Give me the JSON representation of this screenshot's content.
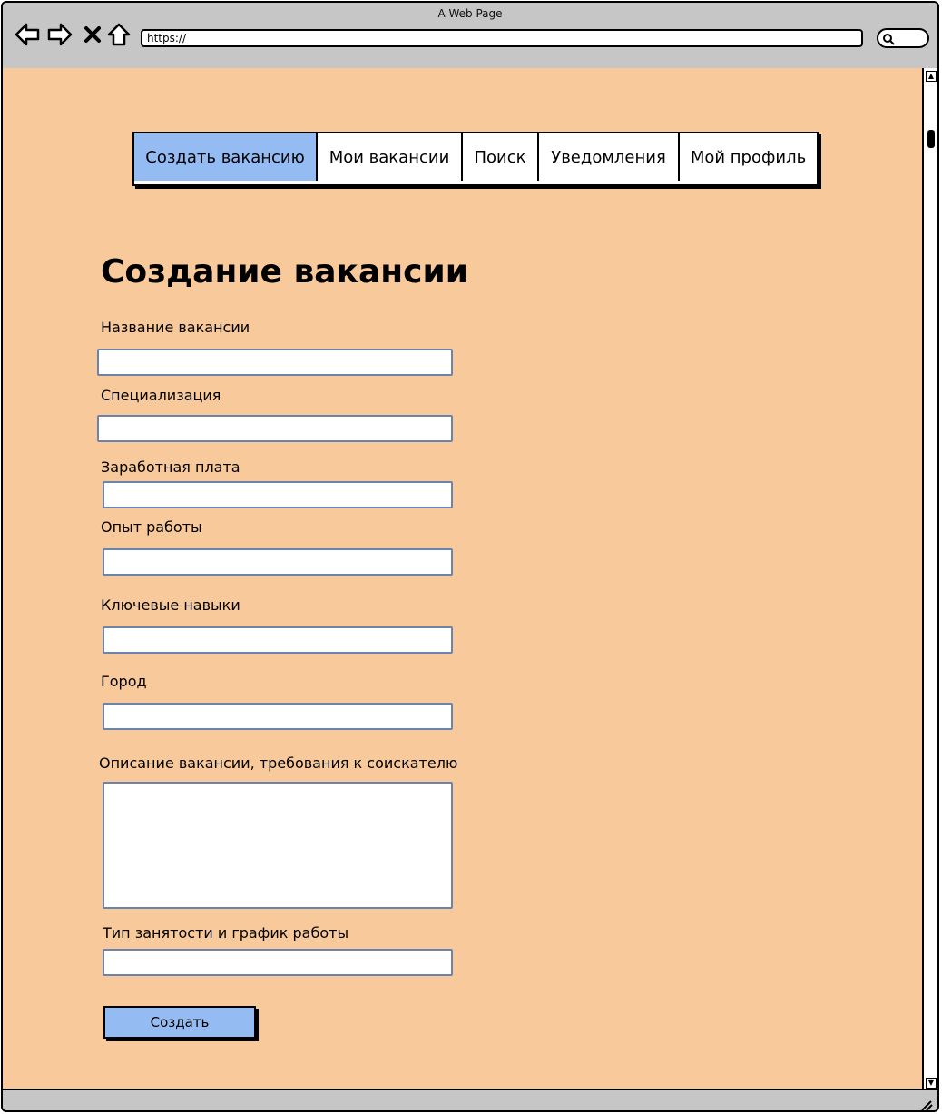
{
  "browser": {
    "window_title": "A Web Page",
    "url": "https://"
  },
  "tabs": [
    {
      "label": "Создать вакансию",
      "active": true
    },
    {
      "label": "Мои вакансии",
      "active": false
    },
    {
      "label": "Поиск",
      "active": false
    },
    {
      "label": "Уведомления",
      "active": false
    },
    {
      "label": "Мой профиль",
      "active": false
    }
  ],
  "page": {
    "title": "Создание вакансии"
  },
  "form": {
    "fields": [
      {
        "label": "Название вакансии",
        "value": ""
      },
      {
        "label": "Специализация",
        "value": ""
      },
      {
        "label": "Заработная плата",
        "value": ""
      },
      {
        "label": "Опыт работы",
        "value": ""
      },
      {
        "label": "Ключевые навыки",
        "value": ""
      },
      {
        "label": "Город",
        "value": ""
      },
      {
        "label": "Описание вакансии, требования к соискателю",
        "value": ""
      },
      {
        "label": "Тип занятости и график работы",
        "value": ""
      }
    ],
    "submit_label": "Создать"
  },
  "colors": {
    "page_background": "#f8c99a",
    "accent": "#94bbf2",
    "input_border": "#6a84ad"
  }
}
